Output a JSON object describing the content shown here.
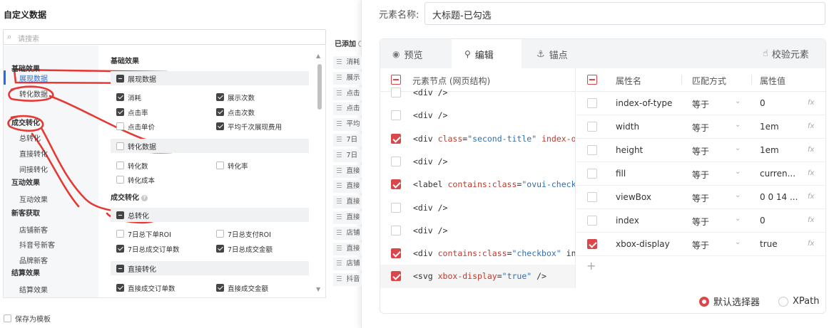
{
  "left": {
    "title": "自定义数据",
    "search_placeholder": "请搜索",
    "save_template": "保存为模板",
    "categories": [
      {
        "group": "基础效果",
        "items": [
          "展现数据",
          "转化数据"
        ]
      },
      {
        "group": "成交转化",
        "items": [
          "总转化",
          "直接转化",
          "间接转化"
        ]
      },
      {
        "group": "互动效果",
        "items": [
          "互动效果"
        ]
      },
      {
        "group": "新客获取",
        "items": [
          "店铺新客",
          "抖音号新客",
          "品牌新客"
        ]
      },
      {
        "group": "结算效果",
        "items": [
          "结算效果"
        ]
      }
    ],
    "active_category": "展现数据",
    "content": {
      "section1": "基础效果",
      "sub1": "展现数据",
      "sub1_opts": [
        "消耗",
        "展示次数",
        "点击率",
        "点击次数",
        "点击单价",
        "平均千次展现费用"
      ],
      "sub2": "转化数据",
      "sub2_opts": [
        "转化数",
        "转化率",
        "转化成本"
      ],
      "section2": "成交转化",
      "sub3": "总转化",
      "sub3_opts": [
        "7日总下单ROI",
        "7日总支付ROI",
        "7日总成交订单数",
        "7日总成交金额"
      ],
      "sub4": "直接转化",
      "sub4_opts": [
        "直接成交订单数",
        "直接成交金额"
      ]
    },
    "added": {
      "label": "已添加",
      "items": [
        "消耗",
        "展示",
        "点击",
        "点击",
        "平均",
        "7日",
        "7日",
        "直接",
        "直接",
        "直接",
        "直接",
        "店铺",
        "直接",
        "店铺",
        "抖音"
      ]
    }
  },
  "right": {
    "name_label": "元素名称:",
    "name_value": "大标题-已勾选",
    "tabs": [
      "预览",
      "编辑",
      "锚点"
    ],
    "verify_label": "校验元素",
    "tree_header": "元素节点 (网页结构)",
    "tree_rows": [
      {
        "checked": false,
        "parts": [
          [
            "t",
            "<div />"
          ]
        ]
      },
      {
        "checked": false,
        "parts": [
          [
            "t",
            "<div />"
          ]
        ]
      },
      {
        "checked": true,
        "parts": [
          [
            "t",
            "<div "
          ],
          [
            "a",
            "class"
          ],
          [
            "t",
            "="
          ],
          [
            "v",
            "\"second-title\""
          ],
          [
            "t",
            " "
          ],
          [
            "a",
            "index-of-typ"
          ],
          [
            "t",
            "..."
          ]
        ]
      },
      {
        "checked": false,
        "parts": [
          [
            "t",
            "<div />"
          ]
        ]
      },
      {
        "checked": true,
        "parts": [
          [
            "t",
            "<label "
          ],
          [
            "a",
            "contains:class"
          ],
          [
            "t",
            "="
          ],
          [
            "v",
            "\"ovui-checkbox"
          ],
          [
            "t",
            "..."
          ]
        ]
      },
      {
        "checked": false,
        "parts": [
          [
            "t",
            "<div />"
          ]
        ]
      },
      {
        "checked": false,
        "parts": [
          [
            "t",
            "<div />"
          ]
        ]
      },
      {
        "checked": true,
        "parts": [
          [
            "t",
            "<div "
          ],
          [
            "a",
            "contains:class"
          ],
          [
            "t",
            "="
          ],
          [
            "v",
            "\"checkbox\""
          ],
          [
            "t",
            " index..."
          ]
        ]
      },
      {
        "checked": true,
        "parts": [
          [
            "t",
            "<svg "
          ],
          [
            "a",
            "xbox-display"
          ],
          [
            "t",
            "="
          ],
          [
            "v",
            "\"true\""
          ],
          [
            "t",
            " />"
          ]
        ]
      }
    ],
    "attr_headers": [
      "属性名",
      "匹配方式",
      "属性值"
    ],
    "attrs": [
      {
        "checked": false,
        "name": "index-of-type",
        "match": "等于",
        "value": "0"
      },
      {
        "checked": false,
        "name": "width",
        "match": "等于",
        "value": "1em"
      },
      {
        "checked": false,
        "name": "height",
        "match": "等于",
        "value": "1em"
      },
      {
        "checked": false,
        "name": "fill",
        "match": "等于",
        "value": "curren..."
      },
      {
        "checked": false,
        "name": "viewBox",
        "match": "等于",
        "value": "0 0 14 ..."
      },
      {
        "checked": false,
        "name": "index",
        "match": "等于",
        "value": "0"
      },
      {
        "checked": true,
        "name": "xbox-display",
        "match": "等于",
        "value": "true"
      }
    ],
    "fx_label": "fx",
    "add_symbol": "+",
    "selector_options": [
      "默认选择器",
      "XPath"
    ],
    "selected_selector": "默认选择器",
    "accent": "#d9474b"
  }
}
